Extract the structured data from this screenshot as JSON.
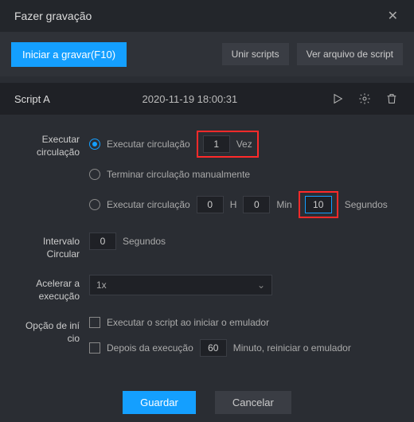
{
  "window": {
    "title": "Fazer gravação"
  },
  "toolbar": {
    "start_record": "Iniciar a gravar(F10)",
    "merge_scripts": "Unir scripts",
    "view_script_file": "Ver arquivo de script"
  },
  "script": {
    "name": "Script A",
    "timestamp": "2020-11-19 18:00:31"
  },
  "labels": {
    "loop_run": "Executar circulação",
    "loop_interval": "Intervalo Circular",
    "accelerate": "Acelerar a execução",
    "startup_opt": "Opção de iní cio"
  },
  "loop": {
    "opt1_label": "Executar circulação",
    "opt1_times_value": "1",
    "opt1_times_unit": "Vez",
    "opt2_label": "Terminar circulação manualmente",
    "opt3_label": "Executar circulação",
    "opt3_h_value": "0",
    "opt3_h_unit": "H",
    "opt3_m_value": "0",
    "opt3_m_unit": "Min",
    "opt3_s_value": "10",
    "opt3_s_unit": "Segundos"
  },
  "interval": {
    "value": "0",
    "unit": "Segundos"
  },
  "speed": {
    "value": "1x"
  },
  "startup": {
    "chk1_label": "Executar o script ao iniciar o emulador",
    "chk2_label": "Depois da execução",
    "chk2_value": "60",
    "chk2_suffix": "Minuto, reiniciar o emulador"
  },
  "footer": {
    "save": "Guardar",
    "cancel": "Cancelar"
  }
}
